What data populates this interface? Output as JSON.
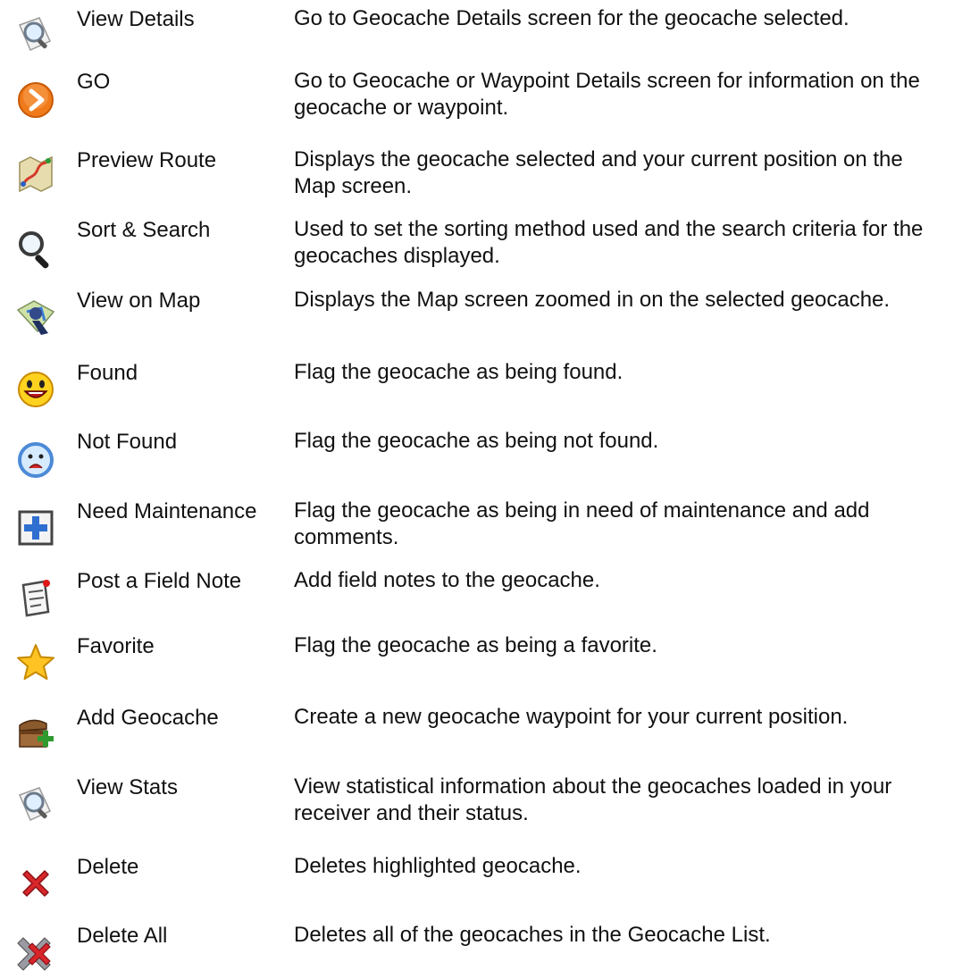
{
  "items": [
    {
      "icon": "magnifier-document-icon",
      "name": "View Details",
      "desc": "Go to Geocache Details screen for the geocache selected."
    },
    {
      "icon": "orange-go-arrow-icon",
      "name": "GO",
      "desc": "Go to Geocache or Waypoint Details screen for information on the geocache or waypoint."
    },
    {
      "icon": "route-map-icon",
      "name": "Preview Route",
      "desc": "Displays the geocache selected and your current position on the Map screen."
    },
    {
      "icon": "magnifying-glass-icon",
      "name": "Sort & Search",
      "desc": "Used to set the sorting method used and the search criteria for the geocaches displayed."
    },
    {
      "icon": "map-pin-icon",
      "name": "View on Map",
      "desc": "Displays the Map screen zoomed in on the selected geocache."
    },
    {
      "icon": "happy-face-icon",
      "name": "Found",
      "desc": "Flag the geocache as being found."
    },
    {
      "icon": "sad-face-icon",
      "name": "Not Found",
      "desc": "Flag the geocache as being not found."
    },
    {
      "icon": "blue-plus-icon",
      "name": "Need Maintenance",
      "desc": "Flag the geocache as being in need of maintenance and add comments."
    },
    {
      "icon": "field-note-icon",
      "name": "Post a Field Note",
      "desc": "Add field notes to the geocache."
    },
    {
      "icon": "star-icon",
      "name": "Favorite",
      "desc": "Flag the geocache as being a favorite."
    },
    {
      "icon": "treasure-chest-add-icon",
      "name": "Add Geocache",
      "desc": "Create a new geocache waypoint for your current position."
    },
    {
      "icon": "magnifier-document-icon",
      "name": "View Stats",
      "desc": "View statistical information about the geocaches loaded in your receiver and their status."
    },
    {
      "icon": "red-x-icon",
      "name": "Delete",
      "desc": "Deletes highlighted geocache."
    },
    {
      "icon": "delete-all-icon",
      "name": "Delete All",
      "desc": "Deletes all of the geocaches in the Geocache List."
    }
  ]
}
